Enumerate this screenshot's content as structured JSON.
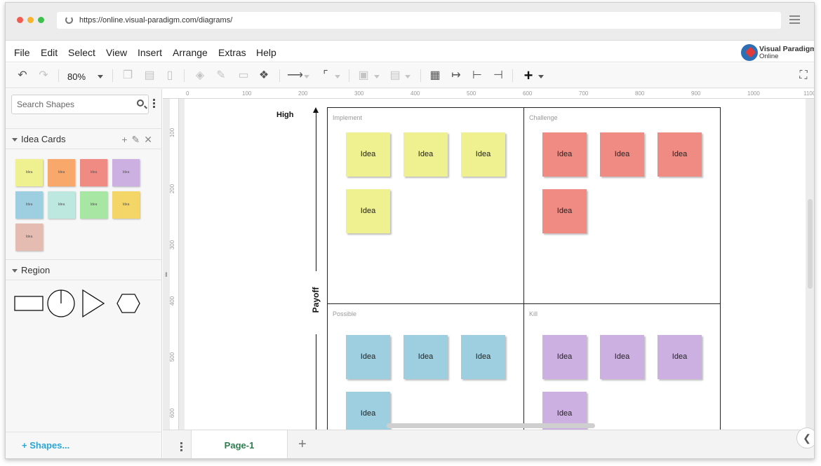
{
  "browser": {
    "url": "https://online.visual-paradigm.com/diagrams/"
  },
  "menubar": {
    "items": [
      "File",
      "Edit",
      "Select",
      "View",
      "Insert",
      "Arrange",
      "Extras",
      "Help"
    ],
    "brand_line1": "Visual Paradigm",
    "brand_line2": "Online"
  },
  "toolbar": {
    "zoom": "80%"
  },
  "sidebar": {
    "search_placeholder": "Search Shapes",
    "sections": [
      {
        "title": "Idea Cards"
      },
      {
        "title": "Region"
      }
    ],
    "swatch_label": "Idea",
    "swatch_colors": [
      "#eff08f",
      "#f9a86b",
      "#f08b83",
      "#cdb0e2",
      "#9ecfe0",
      "#bde8e0",
      "#a7e6a3",
      "#f3d667",
      "#e4bcb1"
    ],
    "shapes_link": "+ Shapes..."
  },
  "rulers": {
    "top": [
      "0",
      "100",
      "200",
      "300",
      "400",
      "500",
      "600",
      "700",
      "800",
      "900",
      "1000",
      "1100"
    ],
    "left": [
      "100",
      "200",
      "300",
      "400",
      "500",
      "600"
    ]
  },
  "diagram": {
    "axis_high": "High",
    "axis_payoff": "Payoff",
    "quadrants": [
      {
        "label": "Implement",
        "color": "#eff08f",
        "cards": [
          "Idea",
          "Idea",
          "Idea",
          "Idea"
        ]
      },
      {
        "label": "Challenge",
        "color": "#f08b83",
        "cards": [
          "Idea",
          "Idea",
          "Idea",
          "Idea"
        ]
      },
      {
        "label": "Possible",
        "color": "#9ecfe0",
        "cards": [
          "Idea",
          "Idea",
          "Idea",
          "Idea"
        ]
      },
      {
        "label": "Kill",
        "color": "#cdb0e2",
        "cards": [
          "Idea",
          "Idea",
          "Idea",
          "Idea"
        ]
      }
    ]
  },
  "pages": {
    "active": "Page-1"
  }
}
